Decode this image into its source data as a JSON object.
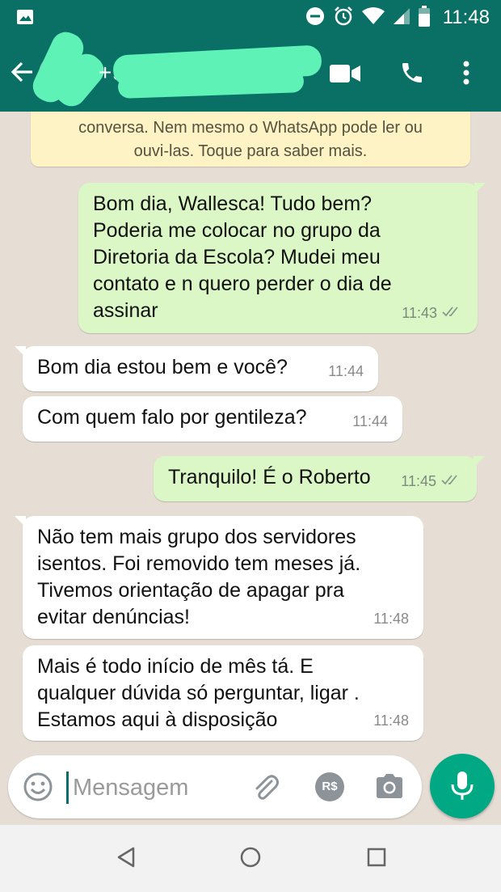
{
  "status_bar": {
    "time": "11:48"
  },
  "header": {
    "contact_name": "+5"
  },
  "encryption_notice": {
    "line1": "conversa. Nem mesmo o WhatsApp pode ler ou",
    "line2": "ouvi-las. Toque para saber mais."
  },
  "messages": [
    {
      "direction": "outgoing",
      "text": "Bom dia, Wallesca! Tudo bem?\nPoderia me colocar no grupo da\nDiretoria da Escola? Mudei meu\ncontato e n quero perder o dia de\nassinar",
      "time": "11:43",
      "status": "read"
    },
    {
      "direction": "incoming",
      "text": "Bom dia estou bem e você?",
      "time": "11:44"
    },
    {
      "direction": "incoming",
      "text": "Com quem falo por gentileza?",
      "time": "11:44"
    },
    {
      "direction": "outgoing",
      "text": "Tranquilo! É o Roberto",
      "time": "11:45",
      "status": "read"
    },
    {
      "direction": "incoming",
      "text": "Não tem mais grupo dos servidores\nisentos. Foi removido tem meses já.\nTivemos orientação de apagar pra\nevitar denúncias!",
      "time": "11:48"
    },
    {
      "direction": "incoming",
      "text": "Mais é todo início de mês tá. E\nqualquer dúvida só perguntar, ligar .\nEstamos aqui à disposição",
      "time": "11:48"
    }
  ],
  "composer": {
    "placeholder": "Mensagem",
    "payment_label": "R$"
  },
  "colors": {
    "header": "#0a7065",
    "outgoing_bubble": "#dcf7c6",
    "incoming_bubble": "#ffffff",
    "accent": "#01a884",
    "notice": "#fdf3c5"
  }
}
